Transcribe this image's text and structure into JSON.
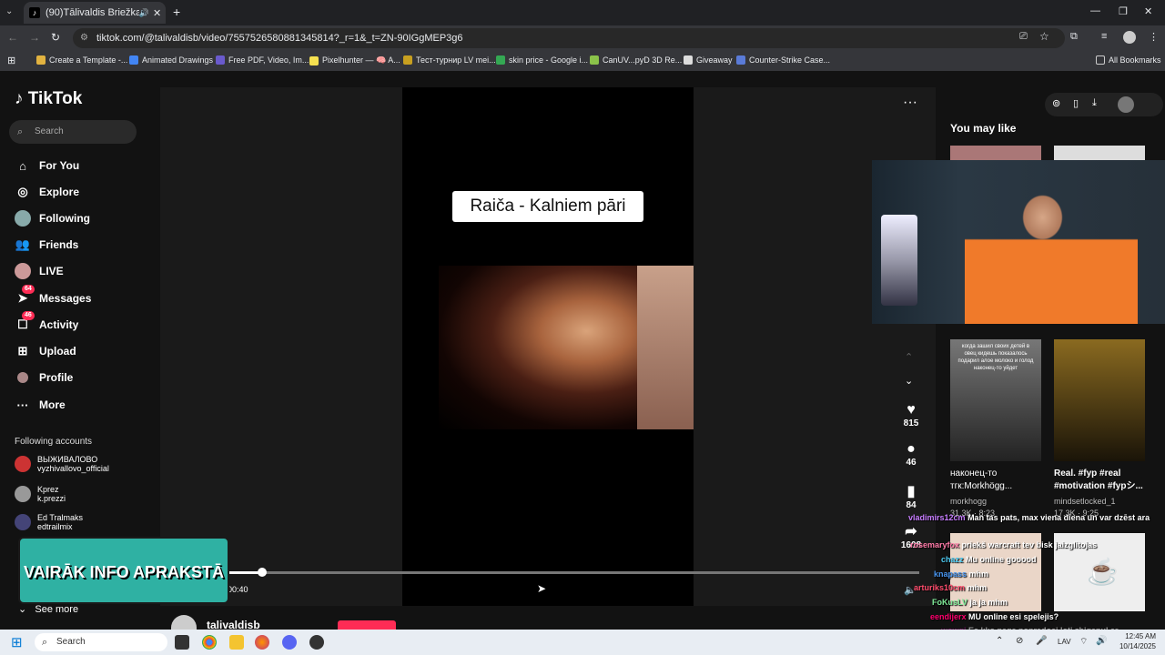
{
  "browser": {
    "tab_title": "(90)Tālivaldis Briežkalns (@",
    "url": "tiktok.com/@talivaldisb/video/7557526580881345814?_r=1&_t=ZN-90IGgMEP3g6",
    "bookmarks": [
      "Create a Template -...",
      "Animated Drawings",
      "Free PDF, Video, Im...",
      "Pixelhunter — 🧠 A...",
      "Тест-турнир LV mei...",
      "skin price - Google i...",
      "CanUV...pyD 3D Re...",
      "Giveaway",
      "Counter-Strike Case..."
    ],
    "all_bookmarks": "All Bookmarks"
  },
  "tiktok": {
    "logo": "TikTok",
    "search_placeholder": "Search",
    "nav": [
      {
        "label": "For You",
        "icon": "home-icon"
      },
      {
        "label": "Explore",
        "icon": "compass-icon"
      },
      {
        "label": "Following",
        "icon": "following-avatar-icon"
      },
      {
        "label": "Friends",
        "icon": "friends-icon"
      },
      {
        "label": "LIVE",
        "icon": "live-avatar-icon"
      },
      {
        "label": "Messages",
        "icon": "messages-icon",
        "badge": "64"
      },
      {
        "label": "Activity",
        "icon": "activity-icon",
        "badge": "46"
      },
      {
        "label": "Upload",
        "icon": "upload-icon"
      },
      {
        "label": "Profile",
        "icon": "profile-icon"
      },
      {
        "label": "More",
        "icon": "more-icon"
      }
    ],
    "following_accounts_header": "Following accounts",
    "following": [
      {
        "name": "ВЫЖИВАЛОВО",
        "handle": "vyzhivallovo_official"
      },
      {
        "name": "Kprez",
        "handle": "k.prezzi"
      },
      {
        "name": "Ed Tralmaks",
        "handle": "edtrailmix"
      }
    ],
    "see_more": "See more",
    "video_caption": "Raiča - Kalniem pāri",
    "time": "00:40",
    "progress": 0.05,
    "author": "talivaldisb",
    "likes": "815",
    "comments": "46",
    "saves": "84",
    "shares": "1608",
    "you_may_like": "You may like",
    "cards": [
      {
        "title": "наконец-то тгк:Morkhögg...",
        "author": "morkhogg",
        "stats": "31.3K · 8:23"
      },
      {
        "title": "Real. #fyp #real #motivation #fypシ...",
        "author": "mindsetlocked_1",
        "stats": "17.3K · 9:25"
      }
    ],
    "card_overlay_text": "когда зашил своих детей в овец кидешь показалось подарил алое молоко и голод наконец-то уйдет"
  },
  "stream": {
    "promo": "VAIRĀK INFO APRAKSTĀ",
    "chat": [
      {
        "user": "vladimirs12cm",
        "msg": "Man tas pats, max viena diena un var dzēst ara",
        "color": "#c77dff"
      },
      {
        "user": "rosemaryfox",
        "msg": "priekš warcraft tev bisk jaizglitojas",
        "color": "#ff7aa8"
      },
      {
        "user": "chazz",
        "msg": "Mu online gooood",
        "color": "#4cc9f0"
      },
      {
        "user": "knapass",
        "msg": "mhm",
        "color": "#4895ef"
      },
      {
        "user": "arturiks10cm",
        "msg": "mhm",
        "color": "#ff4d6d"
      },
      {
        "user": "FoKusLV",
        "msg": "ja ja mhm",
        "color": "#80ed99"
      },
      {
        "user": "eendijerx",
        "msg": "MU online esi spelejis?",
        "color": "#ff006e"
      },
      {
        "user": "wowgi",
        "msg": "Es kko page nopradoci ļoti zhiganul ar",
        "color": "#b5179e"
      }
    ]
  },
  "taskbar": {
    "search": "Search",
    "lang": "LAV",
    "time": "12:45 AM",
    "date": "10/14/2025"
  }
}
